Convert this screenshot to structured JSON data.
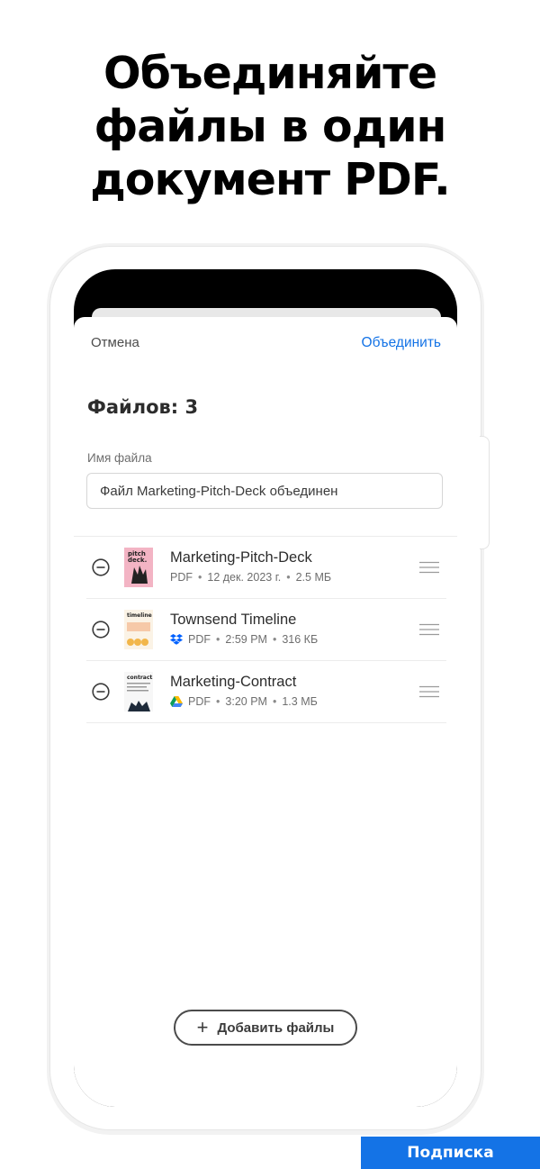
{
  "headline": {
    "line1": "Объединяйте",
    "line2": "файлы в один",
    "line3": "документ PDF."
  },
  "nav": {
    "cancel_label": "Отмена",
    "merge_label": "Объединить"
  },
  "files_count_title": "Файлов: 3",
  "filename_field": {
    "label": "Имя файла",
    "value": "Файл Marketing-Pitch-Deck объединен"
  },
  "files": [
    {
      "name": "Marketing-Pitch-Deck",
      "source_icon": "none",
      "type": "PDF",
      "date": "12 дек. 2023 г.",
      "size": "2.5 МБ",
      "thumb_text": "pitch deck."
    },
    {
      "name": "Townsend Timeline",
      "source_icon": "dropbox-icon",
      "type": "PDF",
      "date": "2:59 PM",
      "size": "316 КБ",
      "thumb_text": "timeline"
    },
    {
      "name": "Marketing-Contract",
      "source_icon": "google-drive-icon",
      "type": "PDF",
      "date": "3:20 PM",
      "size": "1.3 МБ",
      "thumb_text": "contract."
    }
  ],
  "add_files_label": "Добавить файлы",
  "subscribe_label": "Подписка",
  "colors": {
    "accent": "#1473e6",
    "text": "#2c2c2c",
    "muted": "#6e6e6e"
  }
}
